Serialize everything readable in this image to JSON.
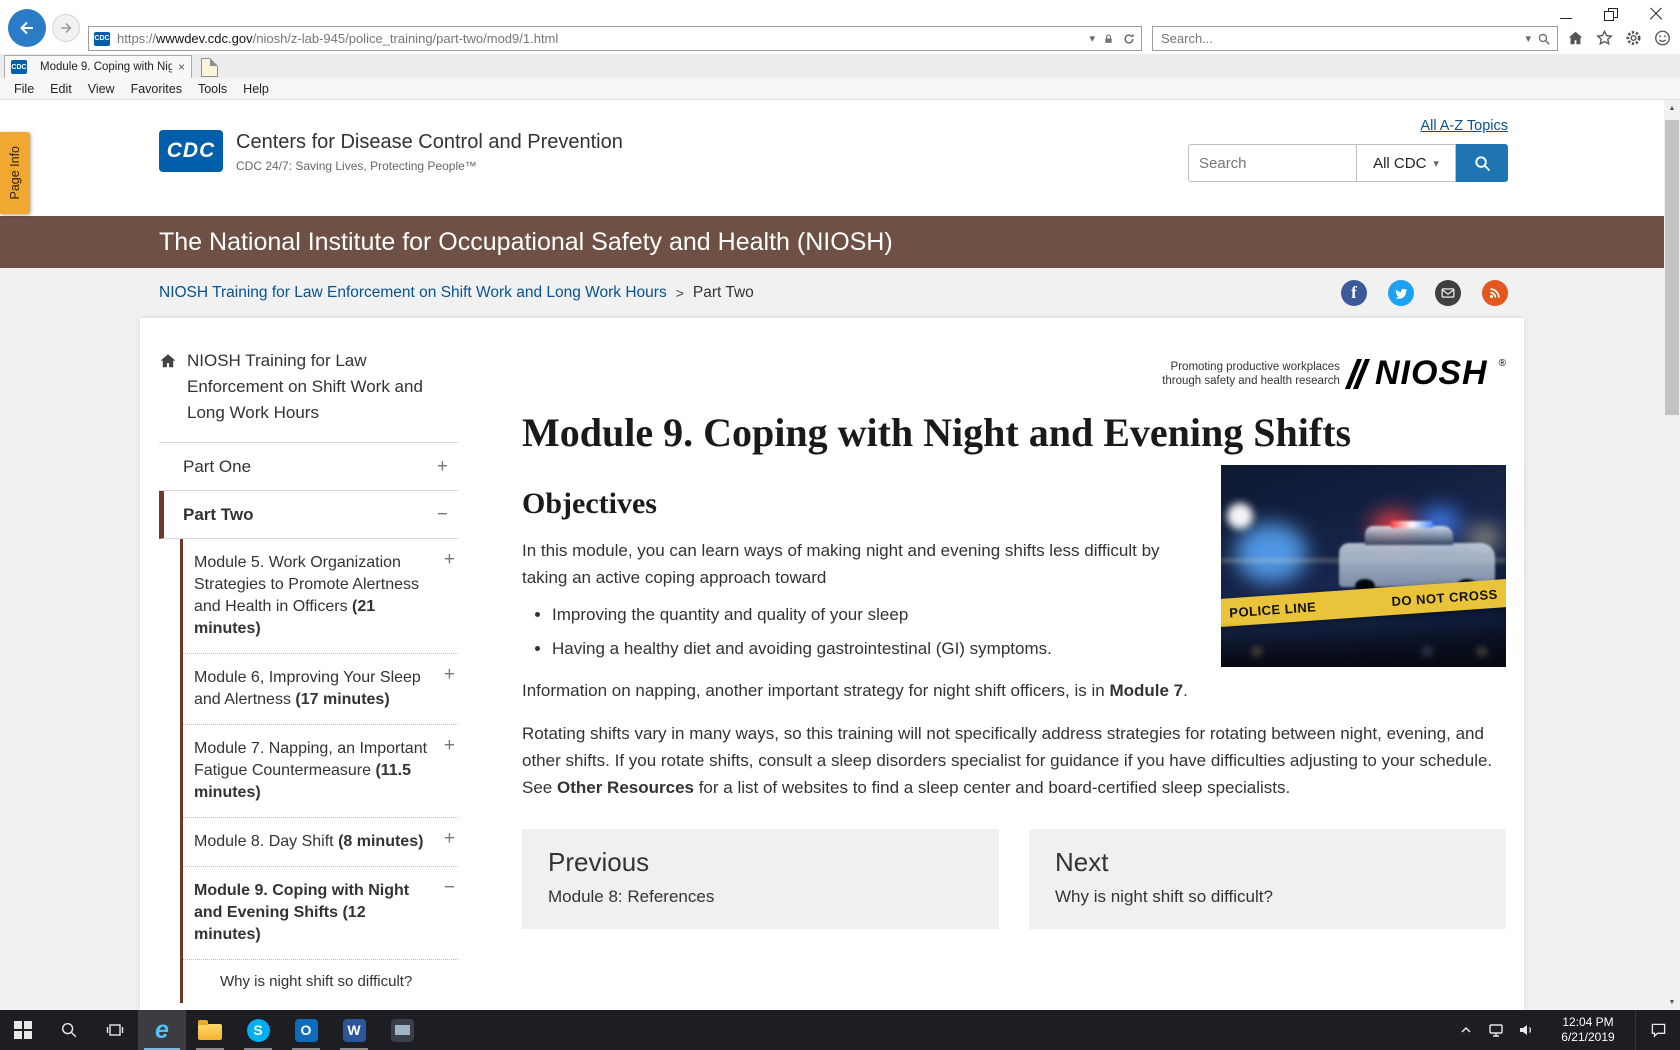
{
  "browser": {
    "tab_title": "Module 9. Coping with Nig...",
    "url": {
      "scheme": "https://",
      "domain": "wwwdev.cdc.gov",
      "path": "/niosh/z-lab-945/police_training/part-two/mod9/1.html"
    },
    "chrome_search_placeholder": "Search...",
    "menu": [
      "File",
      "Edit",
      "View",
      "Favorites",
      "Tools",
      "Help"
    ],
    "favicon_text": "CDC"
  },
  "icons": {
    "caret_down": "▾",
    "scroll_up": "▲",
    "scroll_down": "▼",
    "close": "×",
    "facebook_f": "f",
    "ie_e": "e",
    "skype_s": "S",
    "outlook_o": "O",
    "word_w": "W"
  },
  "page": {
    "page_info_tab": "Page Info",
    "header": {
      "logo_text": "CDC",
      "org_name": "Centers for Disease Control and Prevention",
      "tagline": "CDC 24/7: Saving Lives, Protecting People™",
      "az_topics": "All A-Z Topics",
      "search_placeholder": "Search",
      "search_scope": "All CDC"
    },
    "banner": "The National Institute for Occupational Safety and Health (NIOSH)",
    "breadcrumb": {
      "link": "NIOSH Training for Law Enforcement on Shift Work and Long Work Hours",
      "separator": ">",
      "current": "Part Two"
    },
    "sidebar": {
      "home": "NIOSH Training for Law Enforcement on Shift Work and Long Work Hours",
      "sections": [
        {
          "label": "Part One",
          "expander": "+"
        },
        {
          "label": "Part Two",
          "expander": "−"
        }
      ],
      "modules": [
        {
          "text": "Module 5. Work Organization Strategies to Promote Alertness and Health in Officers ",
          "duration": "(21 minutes)",
          "expander": "+"
        },
        {
          "text": "Module 6, Improving Your Sleep and Alertness ",
          "duration": "(17 minutes)",
          "expander": "+"
        },
        {
          "text": "Module 7. Napping, an Important Fatigue Countermeasure ",
          "duration": "(11.5 minutes)",
          "expander": "+"
        },
        {
          "text": "Module 8. Day Shift ",
          "duration": "(8 minutes)",
          "expander": "+"
        },
        {
          "text": "Module 9. Coping with Night and Evening Shifts ",
          "duration": "(12 minutes)",
          "expander": "−"
        }
      ],
      "subitem": "Why is night shift so difficult?"
    },
    "niosh_logo": {
      "tagline_line1": "Promoting productive workplaces",
      "tagline_line2": "through safety and health research",
      "wordmark": "NIOSH",
      "registered": "®"
    },
    "main": {
      "title": "Module 9. Coping with Night and Evening Shifts",
      "objectives_heading": "Objectives",
      "intro": "In this module, you can learn ways of making night and evening shifts less difficult by taking an active coping approach toward",
      "bullets": [
        "Improving the quantity and quality of your sleep",
        "Having a healthy diet and avoiding gastrointestinal (GI) symptoms."
      ],
      "napping": {
        "pre": "Information on napping, another important strategy for night shift officers, is in ",
        "bold": "Module 7",
        "post": "."
      },
      "rotating": {
        "pre": "Rotating shifts vary in many ways, so this training will not specifically address strategies for rotating between night, evening, and other shifts. If you rotate shifts, consult a sleep disorders specialist for guidance if you have difficulties adjusting to your schedule. See ",
        "bold": "Other Resources",
        "post": " for a list of websites to find a sleep center and board-certified sleep specialists."
      },
      "photo_tape": {
        "left": "POLICE LINE",
        "right": "DO NOT CROSS"
      },
      "pager": {
        "previous_label": "Previous",
        "previous_title": "Module 8: References",
        "next_label": "Next",
        "next_title": "Why is night shift so difficult?"
      }
    }
  },
  "taskbar": {
    "time": "12:04 PM",
    "date": "6/21/2019"
  },
  "colors": {
    "banner_brown": "#6E5044",
    "sidebar_accent_maroon": "#6D392C",
    "link_blue": "#075290",
    "search_button_blue": "#1F74B4",
    "cdc_logo_blue": "#005EAA",
    "page_info_orange": "#F0A830",
    "tape_yellow": "#E9C43B"
  }
}
